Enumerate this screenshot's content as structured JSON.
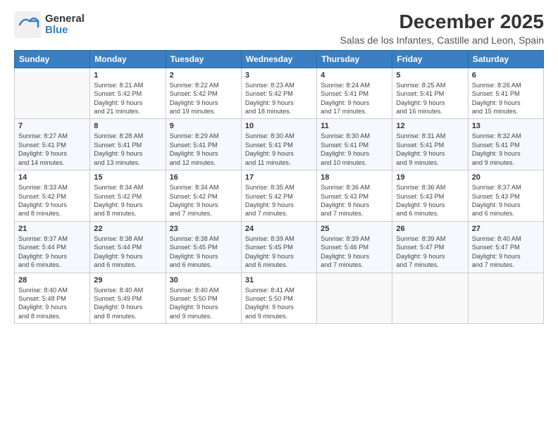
{
  "logo": {
    "general": "General",
    "blue": "Blue"
  },
  "header": {
    "title": "December 2025",
    "subtitle": "Salas de los Infantes, Castille and Leon, Spain"
  },
  "weekdays": [
    "Sunday",
    "Monday",
    "Tuesday",
    "Wednesday",
    "Thursday",
    "Friday",
    "Saturday"
  ],
  "weeks": [
    [
      {
        "day": "",
        "info": ""
      },
      {
        "day": "1",
        "info": "Sunrise: 8:21 AM\nSunset: 5:42 PM\nDaylight: 9 hours\nand 21 minutes."
      },
      {
        "day": "2",
        "info": "Sunrise: 8:22 AM\nSunset: 5:42 PM\nDaylight: 9 hours\nand 19 minutes."
      },
      {
        "day": "3",
        "info": "Sunrise: 8:23 AM\nSunset: 5:42 PM\nDaylight: 9 hours\nand 18 minutes."
      },
      {
        "day": "4",
        "info": "Sunrise: 8:24 AM\nSunset: 5:41 PM\nDaylight: 9 hours\nand 17 minutes."
      },
      {
        "day": "5",
        "info": "Sunrise: 8:25 AM\nSunset: 5:41 PM\nDaylight: 9 hours\nand 16 minutes."
      },
      {
        "day": "6",
        "info": "Sunrise: 8:26 AM\nSunset: 5:41 PM\nDaylight: 9 hours\nand 15 minutes."
      }
    ],
    [
      {
        "day": "7",
        "info": "Sunrise: 8:27 AM\nSunset: 5:41 PM\nDaylight: 9 hours\nand 14 minutes."
      },
      {
        "day": "8",
        "info": "Sunrise: 8:28 AM\nSunset: 5:41 PM\nDaylight: 9 hours\nand 13 minutes."
      },
      {
        "day": "9",
        "info": "Sunrise: 8:29 AM\nSunset: 5:41 PM\nDaylight: 9 hours\nand 12 minutes."
      },
      {
        "day": "10",
        "info": "Sunrise: 8:30 AM\nSunset: 5:41 PM\nDaylight: 9 hours\nand 11 minutes."
      },
      {
        "day": "11",
        "info": "Sunrise: 8:30 AM\nSunset: 5:41 PM\nDaylight: 9 hours\nand 10 minutes."
      },
      {
        "day": "12",
        "info": "Sunrise: 8:31 AM\nSunset: 5:41 PM\nDaylight: 9 hours\nand 9 minutes."
      },
      {
        "day": "13",
        "info": "Sunrise: 8:32 AM\nSunset: 5:41 PM\nDaylight: 9 hours\nand 9 minutes."
      }
    ],
    [
      {
        "day": "14",
        "info": "Sunrise: 8:33 AM\nSunset: 5:42 PM\nDaylight: 9 hours\nand 8 minutes."
      },
      {
        "day": "15",
        "info": "Sunrise: 8:34 AM\nSunset: 5:42 PM\nDaylight: 9 hours\nand 8 minutes."
      },
      {
        "day": "16",
        "info": "Sunrise: 8:34 AM\nSunset: 5:42 PM\nDaylight: 9 hours\nand 7 minutes."
      },
      {
        "day": "17",
        "info": "Sunrise: 8:35 AM\nSunset: 5:42 PM\nDaylight: 9 hours\nand 7 minutes."
      },
      {
        "day": "18",
        "info": "Sunrise: 8:36 AM\nSunset: 5:43 PM\nDaylight: 9 hours\nand 7 minutes."
      },
      {
        "day": "19",
        "info": "Sunrise: 8:36 AM\nSunset: 5:43 PM\nDaylight: 9 hours\nand 6 minutes."
      },
      {
        "day": "20",
        "info": "Sunrise: 8:37 AM\nSunset: 5:43 PM\nDaylight: 9 hours\nand 6 minutes."
      }
    ],
    [
      {
        "day": "21",
        "info": "Sunrise: 8:37 AM\nSunset: 5:44 PM\nDaylight: 9 hours\nand 6 minutes."
      },
      {
        "day": "22",
        "info": "Sunrise: 8:38 AM\nSunset: 5:44 PM\nDaylight: 9 hours\nand 6 minutes."
      },
      {
        "day": "23",
        "info": "Sunrise: 8:38 AM\nSunset: 5:45 PM\nDaylight: 9 hours\nand 6 minutes."
      },
      {
        "day": "24",
        "info": "Sunrise: 8:39 AM\nSunset: 5:45 PM\nDaylight: 9 hours\nand 6 minutes."
      },
      {
        "day": "25",
        "info": "Sunrise: 8:39 AM\nSunset: 5:46 PM\nDaylight: 9 hours\nand 7 minutes."
      },
      {
        "day": "26",
        "info": "Sunrise: 8:39 AM\nSunset: 5:47 PM\nDaylight: 9 hours\nand 7 minutes."
      },
      {
        "day": "27",
        "info": "Sunrise: 8:40 AM\nSunset: 5:47 PM\nDaylight: 9 hours\nand 7 minutes."
      }
    ],
    [
      {
        "day": "28",
        "info": "Sunrise: 8:40 AM\nSunset: 5:48 PM\nDaylight: 9 hours\nand 8 minutes."
      },
      {
        "day": "29",
        "info": "Sunrise: 8:40 AM\nSunset: 5:49 PM\nDaylight: 9 hours\nand 8 minutes."
      },
      {
        "day": "30",
        "info": "Sunrise: 8:40 AM\nSunset: 5:50 PM\nDaylight: 9 hours\nand 9 minutes."
      },
      {
        "day": "31",
        "info": "Sunrise: 8:41 AM\nSunset: 5:50 PM\nDaylight: 9 hours\nand 9 minutes."
      },
      {
        "day": "",
        "info": ""
      },
      {
        "day": "",
        "info": ""
      },
      {
        "day": "",
        "info": ""
      }
    ]
  ]
}
